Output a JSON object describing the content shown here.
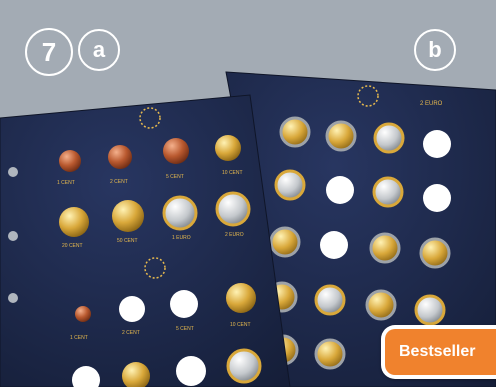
{
  "badges": {
    "number": "7",
    "left_letter": "a",
    "right_letter": "b"
  },
  "ribbon": {
    "label": "Bestseller"
  },
  "sheet_a": {
    "row1_labels": [
      "1 CENT",
      "2 CENT",
      "5 CENT",
      "10 CENT"
    ],
    "row2_labels": [
      "20 CENT",
      "50 CENT",
      "1 EURO",
      "2 EURO"
    ],
    "row3_labels": [
      "1 CENT",
      "2 CENT",
      "5 CENT",
      "10 CENT"
    ]
  },
  "sheet_b": {
    "label": "2 EURO"
  },
  "colors": {
    "background": "#a3abb4",
    "sheet": "#1c2844",
    "accent": "#f0822d",
    "gold": "#e6b94e"
  }
}
